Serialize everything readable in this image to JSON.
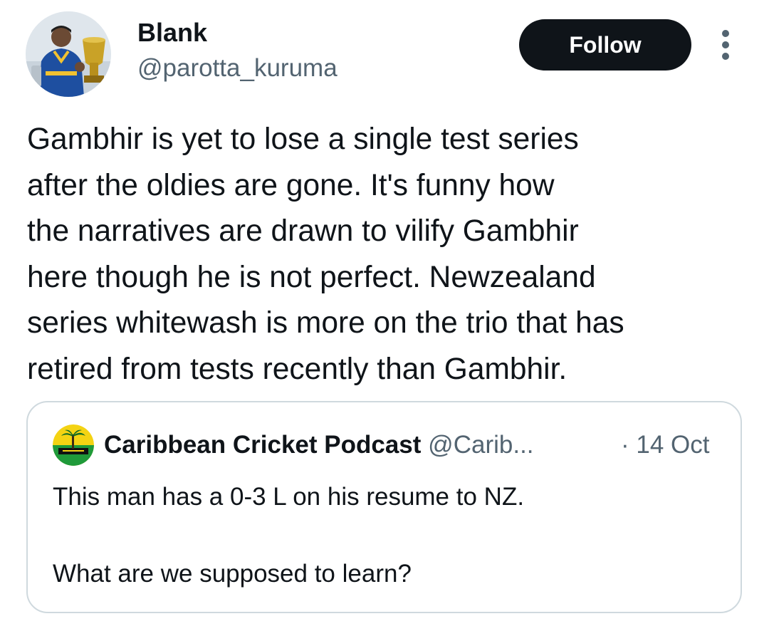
{
  "author": {
    "display_name": "Blank",
    "handle": "@parotta_kuruma",
    "avatar_icon": "profile-photo-cricketer-with-trophy"
  },
  "follow_button": {
    "label": "Follow"
  },
  "more_menu": {
    "icon": "more-vertical-icon"
  },
  "tweet": {
    "lines": [
      "Gambhir is yet to lose a single test series",
      "after the oldies are gone. It's funny how",
      "the narratives are drawn to vilify Gambhir",
      "here though he is not perfect. Newzealand",
      "series whitewash is more on the trio that has",
      "retired from tests recently than Gambhir."
    ]
  },
  "quote": {
    "display_name": "Caribbean Cricket Podcast",
    "handle": "@Carib...",
    "date": "· 14 Oct",
    "avatar_icon": "palm-tree-logo-icon",
    "lines": [
      "This man has a 0-3 L on his resume to NZ.",
      "",
      "What are we supposed to learn?"
    ]
  },
  "colors": {
    "text_primary": "#0f1419",
    "text_secondary": "#536471",
    "border": "#cfd9de",
    "button_bg": "#0f1419",
    "button_text": "#ffffff"
  }
}
